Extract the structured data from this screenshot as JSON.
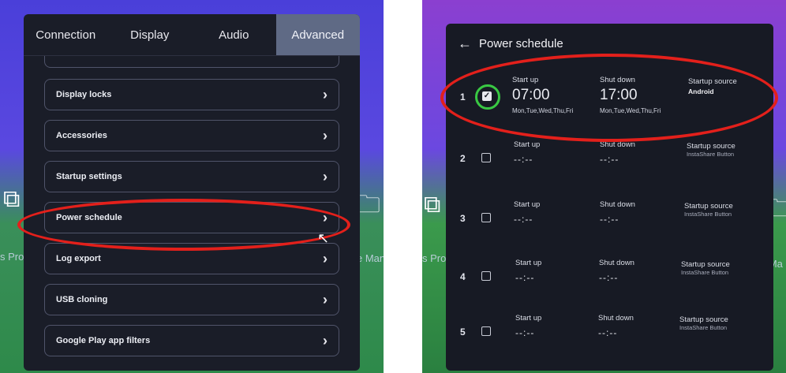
{
  "settings": {
    "tabs": [
      {
        "label": "Connection",
        "active": false
      },
      {
        "label": "Display",
        "active": false
      },
      {
        "label": "Audio",
        "active": false
      },
      {
        "label": "Advanced",
        "active": true
      }
    ],
    "items": [
      {
        "label": "Display locks"
      },
      {
        "label": "Accessories"
      },
      {
        "label": "Startup settings"
      },
      {
        "label": "Power schedule"
      },
      {
        "label": "Log export"
      },
      {
        "label": "USB cloning"
      },
      {
        "label": "Google Play app filters"
      }
    ],
    "chevron": "›"
  },
  "background": {
    "left_text": "s Proje",
    "right_text": "e Mana",
    "right_left_text": "s Proj",
    "right_right_text": "e Ma"
  },
  "schedule": {
    "title": "Power schedule",
    "rows": [
      {
        "num": "1",
        "checked": true,
        "start_label": "Start up",
        "start": "07:00",
        "start_days": "Mon,Tue,Wed,Thu,Fri",
        "shut_label": "Shut down",
        "shut": "17:00",
        "shut_days": "Mon,Tue,Wed,Thu,Fri",
        "source_label": "Startup source",
        "source": "Android"
      },
      {
        "num": "2",
        "checked": false,
        "start_label": "Start up",
        "start": "--:--",
        "shut_label": "Shut down",
        "shut": "--:--",
        "source_label": "Startup source",
        "source": "InstaShare Button"
      },
      {
        "num": "3",
        "checked": false,
        "start_label": "Start up",
        "start": "--:--",
        "shut_label": "Shut down",
        "shut": "--:--",
        "source_label": "Startup source",
        "source": "InstaShare Button"
      },
      {
        "num": "4",
        "checked": false,
        "start_label": "Start up",
        "start": "--:--",
        "shut_label": "Shut down",
        "shut": "--:--",
        "source_label": "Startup source",
        "source": "InstaShare Button"
      },
      {
        "num": "5",
        "checked": false,
        "start_label": "Start up",
        "start": "--:--",
        "shut_label": "Shut down",
        "shut": "--:--",
        "source_label": "Startup source",
        "source": "InstaShare Button"
      }
    ]
  },
  "colors": {
    "highlight_circle": "#e3201b",
    "checked_circle": "#39c843",
    "active_tab": "#5f6a85"
  }
}
